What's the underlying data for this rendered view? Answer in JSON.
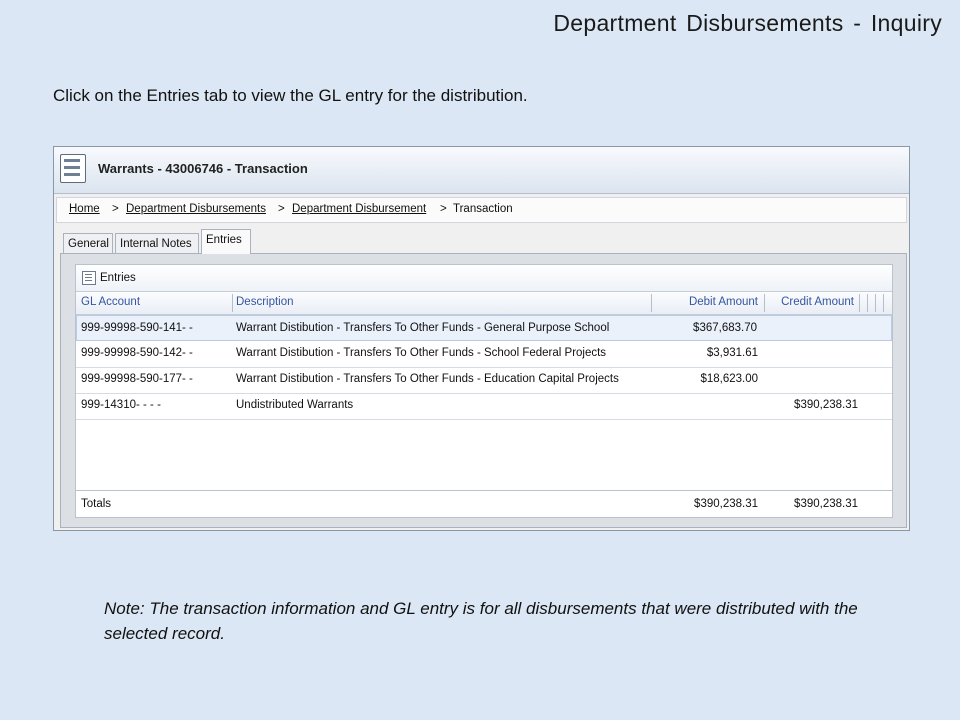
{
  "slide": {
    "title": "Department Disbursements - Inquiry",
    "instruction": "Click on the Entries tab to view the GL entry for the distribution.",
    "note": "Note: The transaction information and GL entry is for all disbursements that were distributed with the selected record."
  },
  "window": {
    "title": "Warrants - 43006746 - Transaction",
    "icon": "form-list-icon"
  },
  "breadcrumb": {
    "items": [
      "Home",
      "Department Disbursements",
      "Department Disbursement",
      "Transaction"
    ],
    "separator": ">"
  },
  "tabs": [
    {
      "label": "General",
      "active": false
    },
    {
      "label": "Internal Notes",
      "active": false
    },
    {
      "label": "Entries",
      "active": true
    }
  ],
  "entries": {
    "title": "Entries",
    "columns": [
      "GL Account",
      "Description",
      "Debit Amount",
      "Credit Amount"
    ],
    "rows": [
      {
        "account": "999-99998-590-141-    -",
        "description": "Warrant Distibution - Transfers To Other Funds - General Purpose School",
        "debit": "$367,683.70",
        "credit": ""
      },
      {
        "account": "999-99998-590-142-    -",
        "description": "Warrant Distibution - Transfers To Other Funds - School Federal Projects",
        "debit": "$3,931.61",
        "credit": ""
      },
      {
        "account": "999-99998-590-177-    -",
        "description": "Warrant Distibution - Transfers To Other Funds - Education Capital Projects",
        "debit": "$18,623.00",
        "credit": ""
      },
      {
        "account": "999-14310-   -   -   -",
        "description": "Undistributed Warrants",
        "debit": "",
        "credit": "$390,238.31"
      }
    ],
    "totals": {
      "label": "Totals",
      "debit": "$390,238.31",
      "credit": "$390,238.31"
    }
  }
}
